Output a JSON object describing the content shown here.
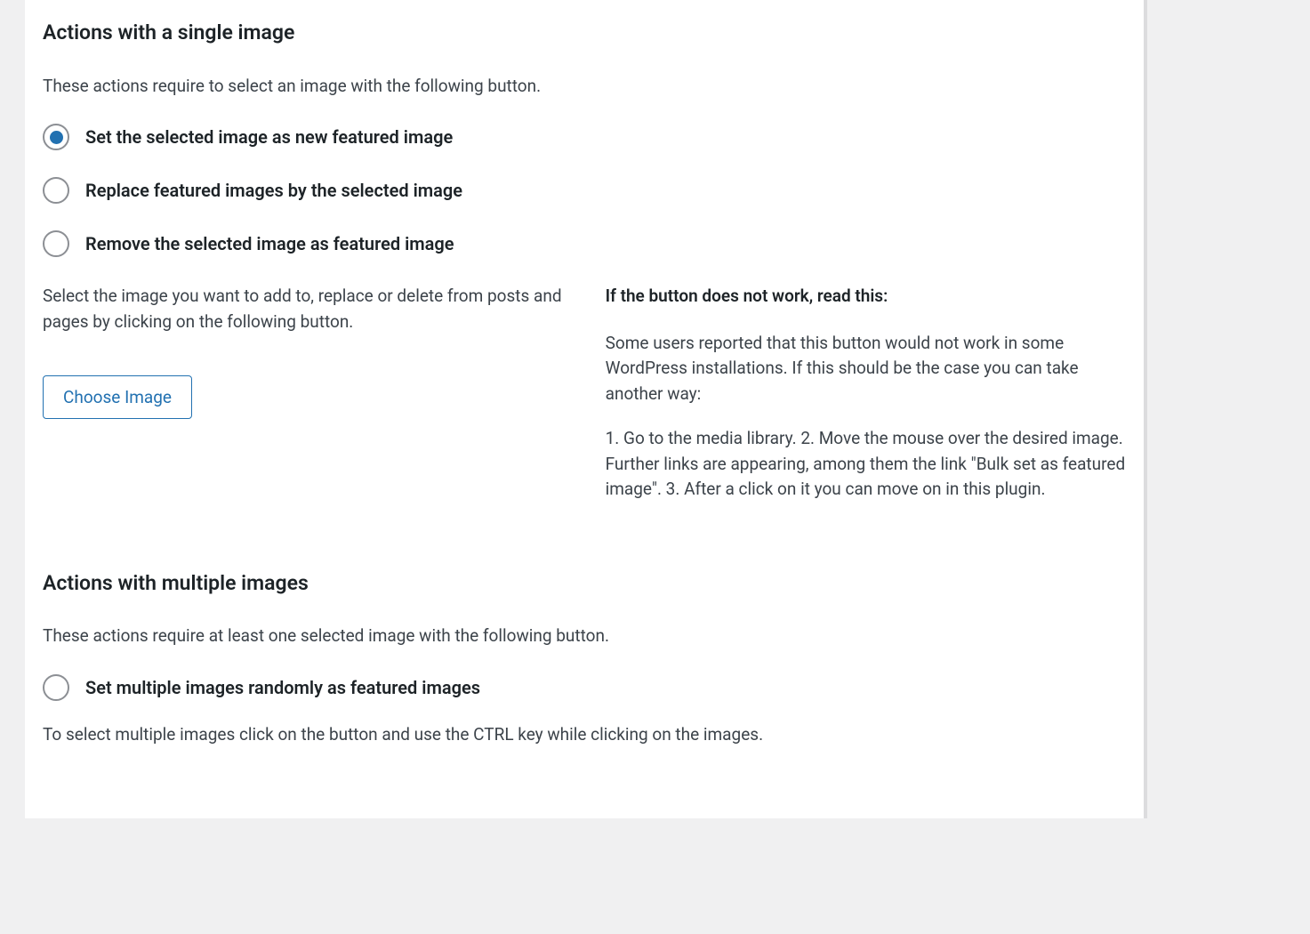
{
  "section_single": {
    "title": "Actions with a single image",
    "description": "These actions require to select an image with the following button.",
    "radios": [
      {
        "label": "Set the selected image as new featured image",
        "selected": true
      },
      {
        "label": "Replace featured images by the selected image",
        "selected": false
      },
      {
        "label": "Remove the selected image as featured image",
        "selected": false
      }
    ],
    "left_description": "Select the image you want to add to, replace or delete from posts and pages by clicking on the following button.",
    "choose_button_label": "Choose Image",
    "right": {
      "heading": "If the button does not work, read this:",
      "paragraph1": "Some users reported that this button would not work in some WordPress installations. If this should be the case you can take another way:",
      "paragraph2": "1. Go to the media library. 2. Move the mouse over the desired image. Further links are appearing, among them the link \"Bulk set as featured image\". 3. After a click on it you can move on in this plugin."
    }
  },
  "section_multiple": {
    "title": "Actions with multiple images",
    "description": "These actions require at least one selected image with the following button.",
    "radios": [
      {
        "label": "Set multiple images randomly as featured images",
        "selected": false
      }
    ],
    "instruction": "To select multiple images click on the button and use the CTRL key while clicking on the images."
  }
}
